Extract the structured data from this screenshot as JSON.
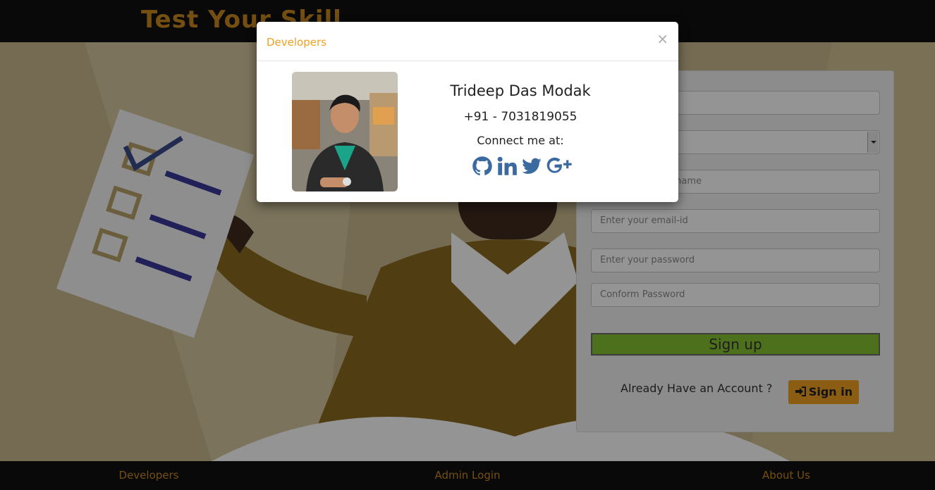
{
  "header": {
    "brand": "Test Your Skill"
  },
  "signup_form": {
    "name_placeholder": "",
    "select_value": "",
    "username_placeholder": "e name",
    "email_placeholder": "Enter your email-id",
    "password_placeholder": "Enter your password",
    "confirm_placeholder": "Conform Password",
    "signup_label": "Sign up",
    "already_text": "Already Have an Account ?",
    "signin_label": "Sign in"
  },
  "footer": {
    "links": [
      "Developers",
      "Admin Login",
      "About Us"
    ]
  },
  "modal": {
    "title": "Developers",
    "close": "×",
    "name": "Trideep Das Modak",
    "phone": "+91 - 7031819055",
    "connect": "Connect me at:",
    "socials": [
      "github-icon",
      "linkedin-icon",
      "twitter-icon",
      "google-plus-icon"
    ]
  },
  "colors": {
    "accent": "#f0a020",
    "brand": "#c8891e",
    "signup_green": "#86c232",
    "social_blue": "#3b6aa0"
  }
}
